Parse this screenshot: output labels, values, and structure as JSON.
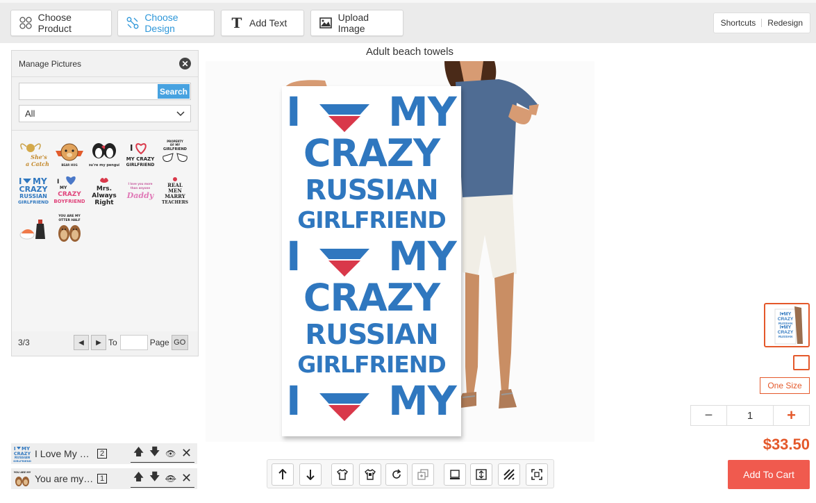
{
  "toolbar": {
    "choose_product": "Choose Product",
    "choose_design": "Choose Design",
    "add_text": "Add Text",
    "upload_image": "Upload Image",
    "shortcuts": "Shortcuts",
    "redesign": "Redesign"
  },
  "panel": {
    "title": "Manage Pictures",
    "search_button": "Search",
    "search_value": "",
    "category": "All",
    "thumbnails": [
      {
        "icon": "snitch-clipart",
        "text": "She's a Catch"
      },
      {
        "icon": "bear-badge-clipart",
        "text": ""
      },
      {
        "icon": "penguins-clipart",
        "text": "you're my penguin"
      },
      {
        "icon": "heart-girlfriend-clipart",
        "text": "I MY CRAZY GIRLFRIEND"
      },
      {
        "icon": "teacher-hands-clipart",
        "text": "PROPERTY OF MY GIRLFRIEND"
      },
      {
        "icon": "russian-girlfriend-clipart",
        "text": "I MY CRAZY RUSSIAN GIRLFRIEND"
      },
      {
        "icon": "crazy-boyfriend-clipart",
        "text": "I MY CRAZY BOYFRIEND"
      },
      {
        "icon": "mrs-always-right-clipart",
        "text": "Mrs. Always Right"
      },
      {
        "icon": "daddy-script-clipart",
        "text": "Daddy"
      },
      {
        "icon": "real-men-teachers-clipart",
        "text": "REAL MEN MARRY TEACHERS"
      },
      {
        "icon": "sushi-soy-clipart",
        "text": ""
      },
      {
        "icon": "otters-clipart",
        "text": "YOU ARE MY OTTER HALF"
      }
    ],
    "page_count": "3/3",
    "to_label": "To",
    "page_label": "Page",
    "go_label": "GO"
  },
  "layers": [
    {
      "name": "I Love My …",
      "number": "2",
      "icon": "russian-girlfriend-clipart"
    },
    {
      "name": "You are my…",
      "number": "1",
      "icon": "otters-clipart"
    }
  ],
  "canvas": {
    "product_title": "Adult beach towels",
    "towel_lines": [
      "I",
      "MY",
      "CRAZY",
      "RUSSIAN",
      "GIRLFRIEND",
      "I",
      "MY",
      "CRAZY",
      "RUSSIAN",
      "GIRLFRIEND",
      "I",
      "MY"
    ]
  },
  "order": {
    "size": "One Size",
    "quantity": "1",
    "minus": "−",
    "plus": "+",
    "price": "$33.50",
    "add_to_cart": "Add To Cart"
  },
  "colors": {
    "accent": "#2e97d9",
    "brand_orange": "#e4582a",
    "cart_red": "#f05a4e",
    "design_blue": "#2f77bf",
    "heart_red": "#d9384a"
  }
}
